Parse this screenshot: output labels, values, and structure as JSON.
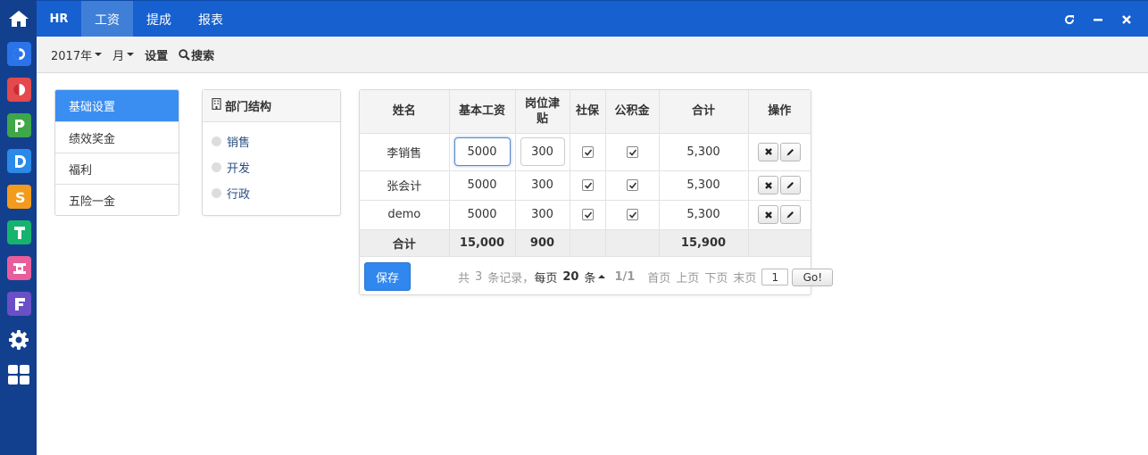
{
  "topbar": {
    "brand": "HR",
    "nav": [
      {
        "label": "工资",
        "active": true
      },
      {
        "label": "提成",
        "active": false
      },
      {
        "label": "报表",
        "active": false
      }
    ]
  },
  "rail": {
    "apps": [
      {
        "letter": "C",
        "color": "#2b73e8"
      },
      {
        "letter": "O",
        "color": "#e5484d"
      },
      {
        "letter": "P",
        "color": "#3fa64a"
      },
      {
        "letter": "D",
        "color": "#2b8ae8"
      },
      {
        "letter": "S",
        "color": "#f29b1d"
      },
      {
        "letter": "T",
        "color": "#15b36e"
      },
      {
        "letter": "H",
        "color": "#e85d9a"
      },
      {
        "letter": "F",
        "color": "#6b4fc7"
      }
    ]
  },
  "toolbar": {
    "year": "2017年",
    "month": "月",
    "settings": "设置",
    "search": "搜索"
  },
  "side_menu": {
    "items": [
      "基础设置",
      "绩效奖金",
      "福利",
      "五险一金"
    ],
    "active_index": 0
  },
  "dept_panel": {
    "title": "部门结构",
    "items": [
      "销售",
      "开发",
      "行政"
    ]
  },
  "grid": {
    "headers": [
      "姓名",
      "基本工资",
      "岗位津\n贴",
      "社保",
      "公积金",
      "合计",
      "操作"
    ],
    "rows": [
      {
        "name": "李销售",
        "base": "5000",
        "allowance": "300",
        "social": true,
        "fund": true,
        "total": "5,300"
      },
      {
        "name": "张会计",
        "base": "5000",
        "allowance": "300",
        "social": true,
        "fund": true,
        "total": "5,300"
      },
      {
        "name": "demo",
        "base": "5000",
        "allowance": "300",
        "social": true,
        "fund": true,
        "total": "5,300"
      }
    ],
    "footer": {
      "label": "合计",
      "base": "15,000",
      "allowance": "900",
      "total": "15,900"
    }
  },
  "pager": {
    "save": "保存",
    "prefix": "共",
    "count": "3",
    "suffix": "条记录，",
    "per_page_label": "每页",
    "per_page": "20",
    "per_page_unit": "条",
    "page_info": "1/1",
    "first": "首页",
    "prev": "上页",
    "next": "下页",
    "last": "末页",
    "page_value": "1",
    "go": "Go!"
  }
}
